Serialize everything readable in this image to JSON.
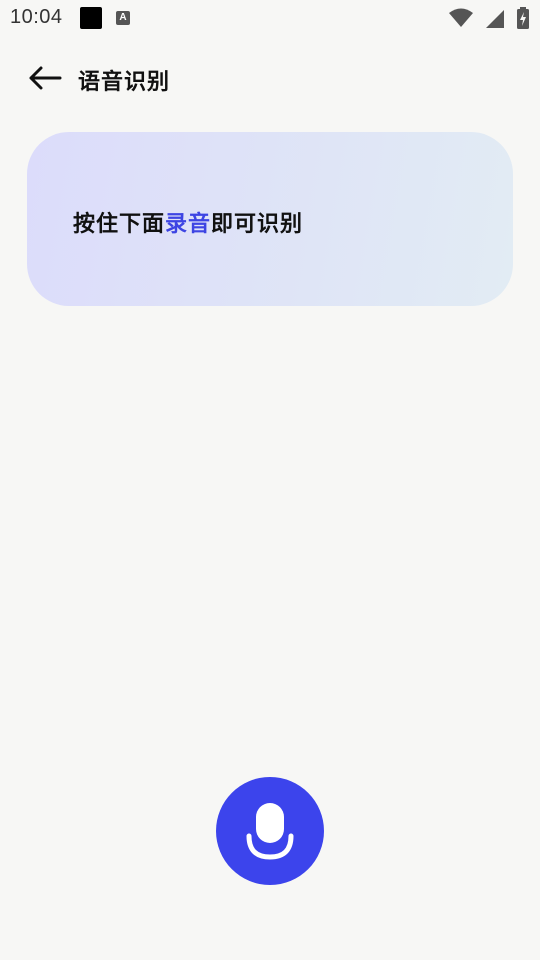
{
  "status_bar": {
    "time": "10:04",
    "notification_icons": [
      "black-square-icon",
      "a-badge-icon"
    ],
    "notification_a_letter": "A",
    "right_icons": [
      "wifi-icon",
      "cellular-signal-icon",
      "battery-charging-icon"
    ]
  },
  "app_bar": {
    "back_icon": "arrow-left-icon",
    "title": "语音识别"
  },
  "hint_card": {
    "text_before": "按住下面",
    "text_highlight": "录音",
    "text_after": "即可识别",
    "highlight_color": "#3d44e3"
  },
  "record_button": {
    "icon": "microphone-icon",
    "color": "#3c44ec"
  }
}
